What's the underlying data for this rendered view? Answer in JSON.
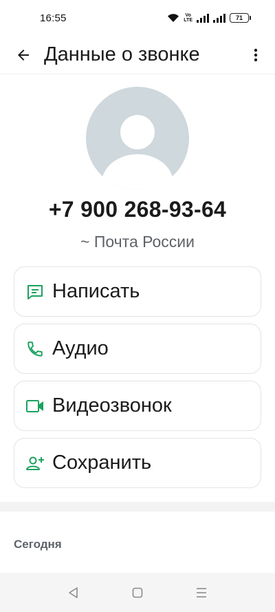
{
  "status_bar": {
    "time": "16:55",
    "volte_top": "Vo",
    "volte_bottom": "LTE",
    "battery": "71"
  },
  "app_bar": {
    "title": "Данные о звонке"
  },
  "contact": {
    "phone": "+7 900 268-93-64",
    "name": "~ Почта России"
  },
  "actions": [
    {
      "label": "Написать",
      "icon": "message-icon"
    },
    {
      "label": "Аудио",
      "icon": "phone-icon"
    },
    {
      "label": "Видеозвонок",
      "icon": "video-icon"
    },
    {
      "label": "Сохранить",
      "icon": "add-person-icon"
    }
  ],
  "history": {
    "section_title": "Сегодня"
  },
  "colors": {
    "accent": "#1aa260",
    "avatar_bg": "#cfd8dc"
  }
}
